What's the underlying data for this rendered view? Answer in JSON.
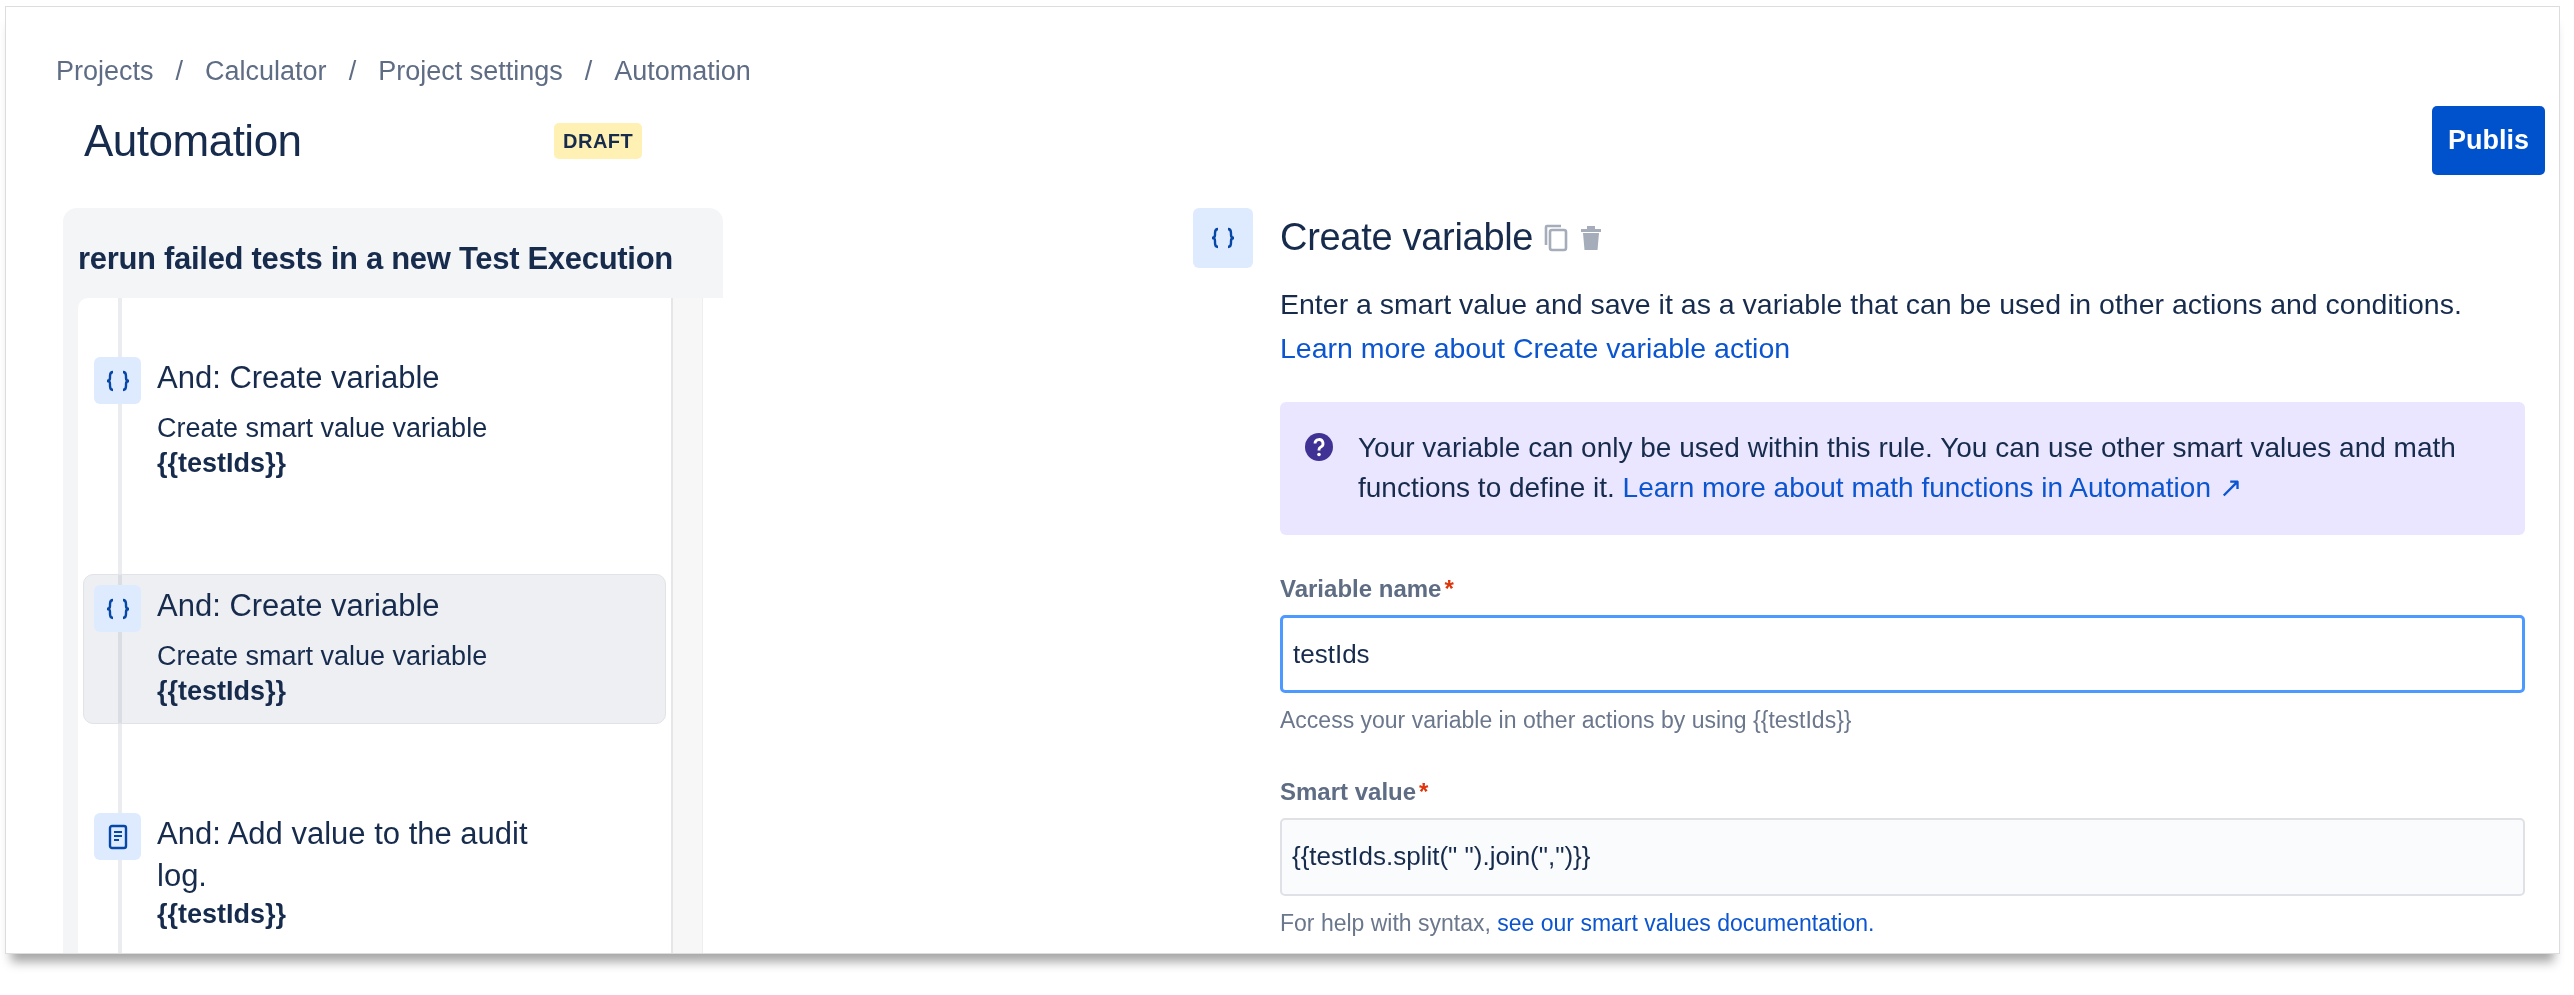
{
  "breadcrumbs": [
    {
      "label": "Projects",
      "separator": "/"
    },
    {
      "label": "Calculator",
      "separator": "/"
    },
    {
      "label": "Project settings",
      "separator": "/"
    },
    {
      "label": "Automation"
    }
  ],
  "title": "Automation",
  "status_badge": "DRAFT",
  "publish_button": "Publis",
  "rule": {
    "name": "rerun failed tests in a new Test Execution",
    "steps": [
      {
        "kind": "variable",
        "title": "And: Create variable",
        "description": "Create smart value variable",
        "value": "{{testIds}}",
        "selected": false
      },
      {
        "kind": "variable",
        "title": "And: Create variable",
        "description": "Create smart value variable",
        "value": "{{testIds}}",
        "selected": true
      },
      {
        "kind": "log",
        "title": "And: Add value to the audit log.",
        "value": "{{testIds}}",
        "selected": false
      }
    ]
  },
  "editor": {
    "kind": "variable",
    "title": "Create variable",
    "description": "Enter a smart value and save it as a variable that can be used in other actions and conditions.",
    "learn_link": "Learn more about Create variable action",
    "info": {
      "text": "Your variable can only be used within this rule. You can use other smart values and math functions to define it.",
      "link": "Learn more about math functions in Automation ↗"
    },
    "fields": [
      {
        "label": "Variable name",
        "required_mark": "*",
        "value": "testIds",
        "focused": true,
        "help": "Access your variable in other actions by using {{testIds}}"
      },
      {
        "label": "Smart value",
        "required_mark": "*",
        "value": "{{testIds.split(\" \").join(\",\")}}",
        "focused": false,
        "help": "For help with syntax,",
        "help_link": "see our smart values documentation."
      }
    ]
  }
}
